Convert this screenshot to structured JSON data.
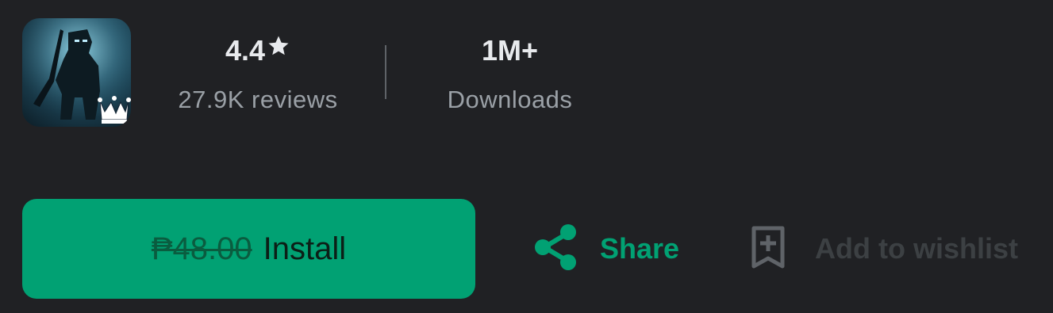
{
  "app": {
    "icon": "app-icon-hooded-warrior-with-crown"
  },
  "stats": {
    "rating_value": "4.4",
    "rating_star": "★",
    "rating_label": "27.9K reviews",
    "downloads_value": "1M+",
    "downloads_label": "Downloads"
  },
  "actions": {
    "old_price": "₱48.00",
    "install_label": "Install",
    "share_label": "Share",
    "wishlist_label": "Add to wishlist"
  },
  "colors": {
    "background": "#202124",
    "accent_green": "#01a173",
    "muted_text": "#9aa0a6",
    "disabled": "#3c4043"
  },
  "icons": {
    "share": "share-icon",
    "wishlist": "bookmark-add-icon",
    "star": "star-icon"
  }
}
